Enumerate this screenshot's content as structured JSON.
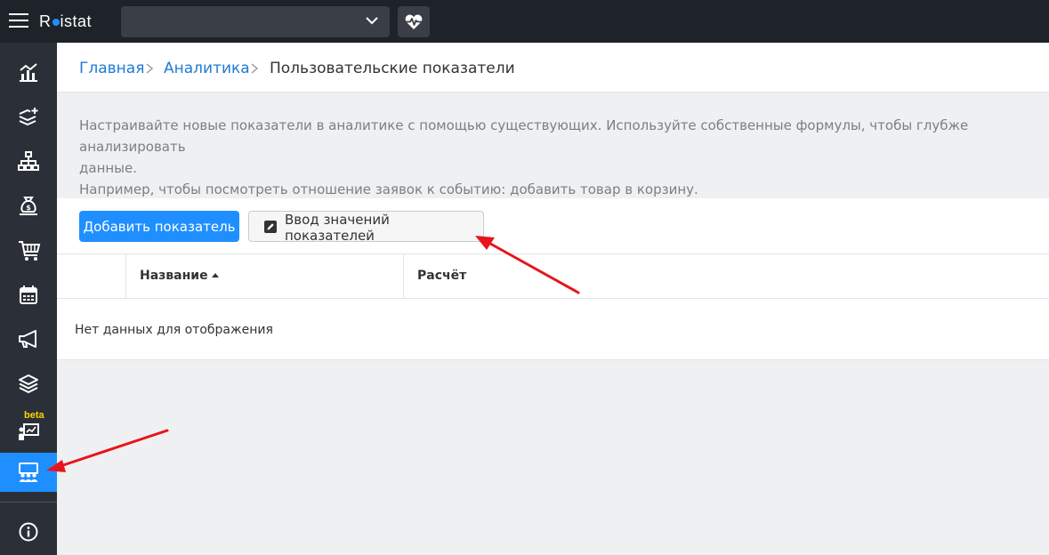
{
  "app": {
    "logo_text_1": "R",
    "logo_text_2": "istat",
    "project_select_value": ""
  },
  "breadcrumb": {
    "items": [
      {
        "label": "Главная"
      },
      {
        "label": "Аналитика"
      },
      {
        "label": "Пользовательские показатели"
      }
    ]
  },
  "sidebar": {
    "items": [
      {
        "icon": "analytics-chart-icon"
      },
      {
        "icon": "add-layers-icon"
      },
      {
        "icon": "sitemap-icon"
      },
      {
        "icon": "money-bag-icon"
      },
      {
        "icon": "shopping-cart-icon"
      },
      {
        "icon": "calendar-icon"
      },
      {
        "icon": "megaphone-icon"
      },
      {
        "icon": "layers-icon"
      },
      {
        "icon": "presentation-chart-icon",
        "badge": "beta"
      },
      {
        "icon": "user-group-board-icon",
        "active": true
      },
      {
        "icon": "info-icon"
      }
    ]
  },
  "description": {
    "line1": "Настраивайте новые показатели в аналитике с помощью существующих. Используйте собственные формулы, чтобы глубже анализировать",
    "line2": "данные.",
    "line3": "Например, чтобы посмотреть отношение заявок к событию: добавить товар в корзину."
  },
  "toolbar": {
    "add_label": "Добавить показатель",
    "enter_values_label": "Ввод значений показателей"
  },
  "table": {
    "columns": [
      {
        "label": ""
      },
      {
        "label": "Название",
        "sort": "asc"
      },
      {
        "label": "Расчёт"
      }
    ],
    "empty_message": "Нет данных для отображения"
  },
  "colors": {
    "accent": "#1f8fff",
    "topbar": "#1e2229",
    "sidebar": "#2b3038",
    "annotation_arrow": "#e8141c",
    "beta_badge": "#ffd400"
  }
}
